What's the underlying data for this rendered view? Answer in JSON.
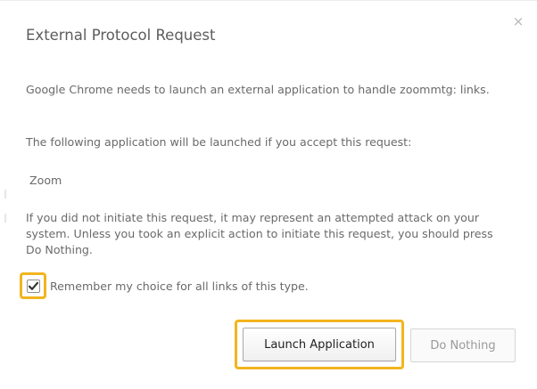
{
  "dialog": {
    "title": "External Protocol Request",
    "close_label": "×",
    "description": "Google Chrome needs to launch an external application to handle zoommtg: links.",
    "following_text": "The following application will be launched if you accept this request:",
    "application_name": "Zoom",
    "warning": "If you did not initiate this request, it may represent an attempted attack on your system. Unless you took an explicit action to initiate this request, you should press Do Nothing.",
    "remember_label": "Remember my choice for all links of this type.",
    "remember_checked": true,
    "launch_button": "Launch Application",
    "do_nothing_button": "Do Nothing"
  },
  "colors": {
    "highlight": "#f2b51e",
    "text": "#6a6a6a",
    "disabled_text": "#9a9a9a"
  },
  "icons": {
    "close": "close-icon",
    "check": "checkmark-icon"
  }
}
